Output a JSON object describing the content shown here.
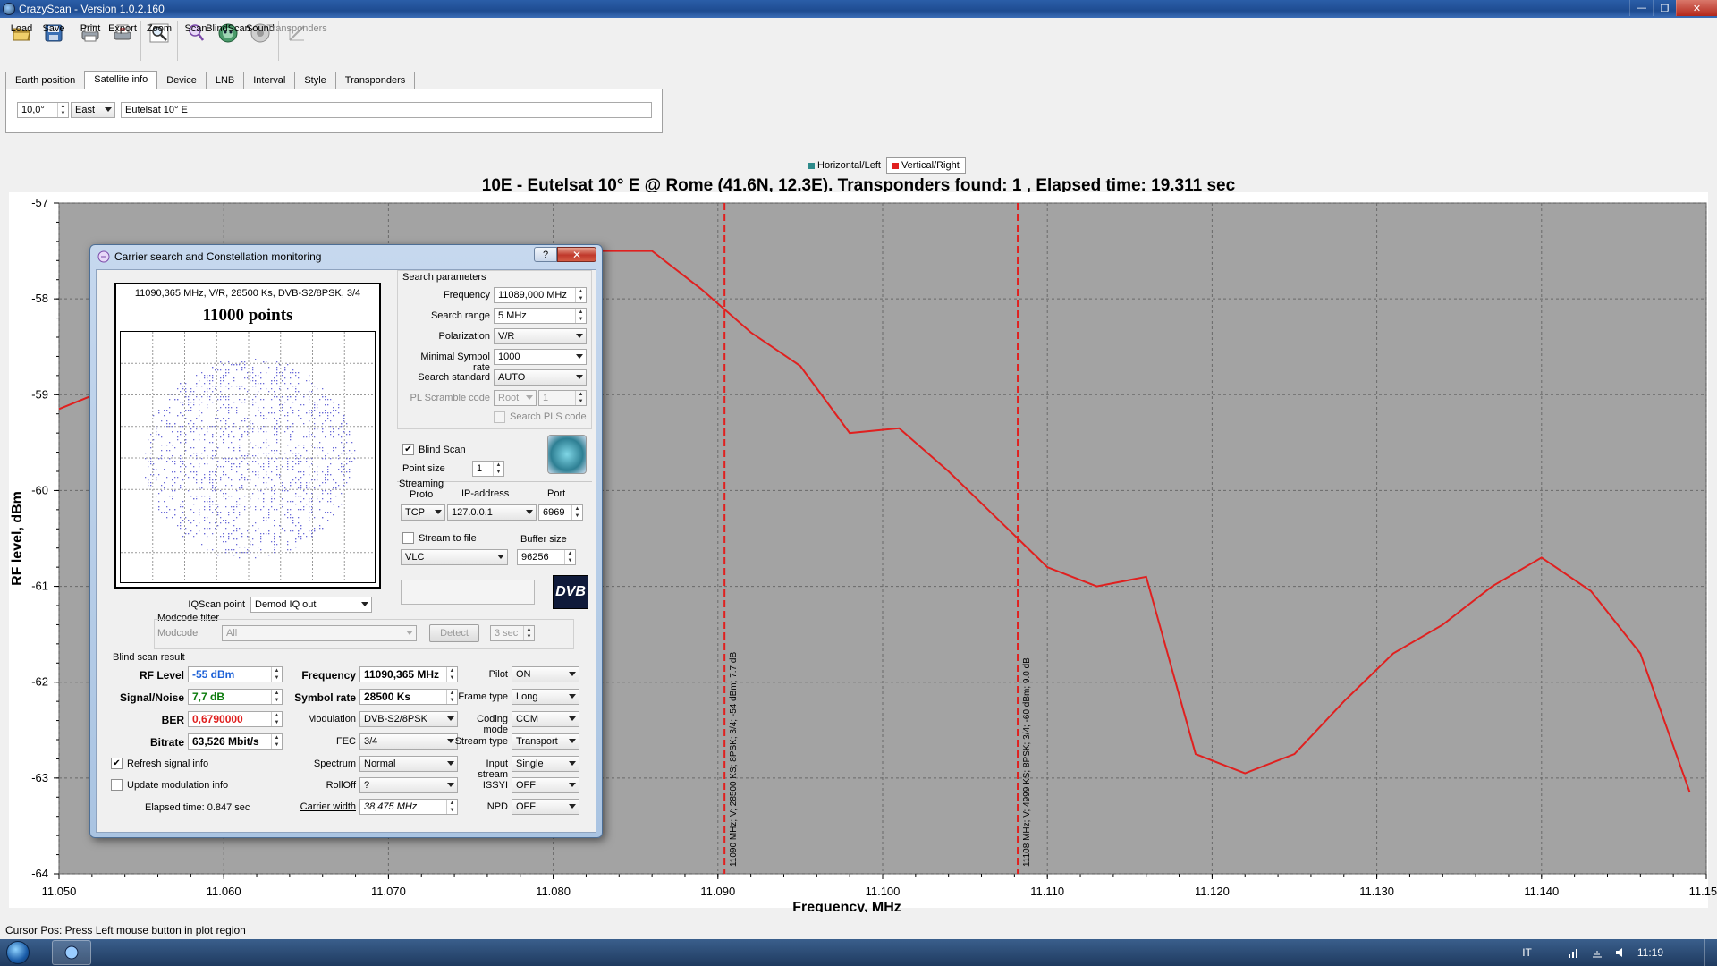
{
  "window": {
    "title": "CrazyScan - Version 1.0.2.160"
  },
  "toolbar": {
    "buttons": [
      {
        "id": "load",
        "label": "Load",
        "icon": "load-icon"
      },
      {
        "id": "save",
        "label": "Save",
        "icon": "save-icon"
      },
      {
        "id": "print",
        "label": "Print",
        "icon": "print-icon"
      },
      {
        "id": "export",
        "label": "Export",
        "icon": "export-icon"
      },
      {
        "id": "zoom",
        "label": "Zoom",
        "icon": "zoom-icon"
      },
      {
        "id": "scan",
        "label": "Scan",
        "icon": "scan-icon"
      },
      {
        "id": "blindscan",
        "label": "BlindScan",
        "icon": "blindscan-icon"
      },
      {
        "id": "sound",
        "label": "Sound",
        "icon": "sound-icon"
      },
      {
        "id": "transponders",
        "label": "Transponders",
        "icon": "transponders-icon",
        "disabled": true
      }
    ]
  },
  "tabs": [
    "Earth position",
    "Satellite info",
    "Device",
    "LNB",
    "Interval",
    "Style",
    "Transponders"
  ],
  "active_tab": "Satellite info",
  "satellite_info": {
    "position": "10,0°",
    "direction": "East",
    "name": "Eutelsat 10° E"
  },
  "legend": {
    "horizontal": "Horizontal/Left",
    "vertical": "Vertical/Right"
  },
  "colors": {
    "horizontal": "#2e8b8b",
    "vertical": "#e0201f",
    "plot_bg": "#a3a3a3"
  },
  "chart_data": {
    "type": "line",
    "title": "10E - Eutelsat 10° E  @ Rome (41.6N, 12.3E). Transponders found: 1 , Elapsed time: 19.311 sec",
    "xlabel": "Frequency, MHz",
    "ylabel": "RF level, dBm",
    "xlim": [
      11.05,
      11.15
    ],
    "ylim": [
      -64,
      -57
    ],
    "x_ticks": [
      "11.050",
      "11.060",
      "11.070",
      "11.080",
      "11.090",
      "11.100",
      "11.110",
      "11.120",
      "11.130",
      "11.140",
      "11.150"
    ],
    "y_ticks": [
      "-57",
      "-58",
      "-59",
      "-60",
      "-61",
      "-62",
      "-63",
      "-64"
    ],
    "grid": true,
    "series": [
      {
        "name": "Vertical/Right",
        "x": [
          11.05,
          11.055,
          11.08,
          11.086,
          11.089,
          11.092,
          11.095,
          11.098,
          11.101,
          11.104,
          11.107,
          11.11,
          11.113,
          11.116,
          11.119,
          11.122,
          11.125,
          11.128,
          11.131,
          11.134,
          11.137,
          11.14,
          11.143,
          11.146,
          11.149
        ],
        "y": [
          -59.15,
          -58.8,
          -57.5,
          -57.5,
          -57.9,
          -58.35,
          -58.7,
          -59.4,
          -59.35,
          -59.8,
          -60.3,
          -60.8,
          -61.0,
          -60.9,
          -62.75,
          -62.95,
          -62.75,
          -62.2,
          -61.7,
          -61.4,
          -61.0,
          -60.7,
          -61.05,
          -61.7,
          -63.15
        ]
      }
    ],
    "markers": [
      {
        "x": 11.0904,
        "label": "11090 MHz; V; 28500 KS; 8PSK; 3/4; -54 dBm; 7.7 dB"
      },
      {
        "x": 11.1082,
        "label": "11108 MHz; V; 4999 KS; 8PSK; 3/4; -60 dBm; 9.0 dB"
      }
    ]
  },
  "status": {
    "text": "Cursor Pos: Press Left mouse button in plot region"
  },
  "taskbar": {
    "language": "IT",
    "clock": "11:19"
  },
  "dialog": {
    "title": "Carrier search and Constellation monitoring",
    "help_label": "?",
    "close_label": "✕",
    "constellation": {
      "info": "11090,365 MHz, V/R, 28500 Ks, DVB-S2/8PSK, 3/4",
      "points": "11000 points"
    },
    "search_params": {
      "group": "Search parameters",
      "frequency_label": "Frequency",
      "frequency": "11089,000 MHz",
      "range_label": "Search range",
      "range": "5 MHz",
      "polarization_label": "Polarization",
      "polarization": "V/R",
      "min_sr_label": "Minimal Symbol rate",
      "min_sr": "1000",
      "standard_label": "Search standard",
      "standard": "AUTO",
      "pls_label": "PL Scramble code",
      "pls_mode": "Root",
      "pls_value": "1",
      "search_pls_label": "Search PLS code"
    },
    "blind_scan_label": "Blind Scan",
    "point_size_label": "Point size",
    "point_size": "1",
    "streaming": {
      "group": "Streaming",
      "proto_label": "Proto",
      "ip_label": "IP-address",
      "port_label": "Port",
      "proto": "TCP",
      "ip": "127.0.0.1",
      "port": "6969",
      "to_file_label": "Stream to file",
      "buffer_label": "Buffer size",
      "player": "VLC",
      "buffer": "96256"
    },
    "iqscan_label": "IQScan point",
    "iqscan": "Demod IQ out",
    "modcode": {
      "group": "Modcode filter",
      "label": "Modcode",
      "value": "All",
      "detect_label": "Detect",
      "time": "3 sec"
    },
    "result": {
      "group": "Blind scan result",
      "rf_label": "RF Level",
      "rf": "-55 dBm",
      "sn_label": "Signal/Noise",
      "sn": "7,7 dB",
      "ber_label": "BER",
      "ber": "0,6790000",
      "bitrate_label": "Bitrate",
      "bitrate": "63,526 Mbit/s",
      "freq_label": "Frequency",
      "freq": "11090,365 MHz",
      "sr_label": "Symbol rate",
      "sr": "28500 Ks",
      "mod_label": "Modulation",
      "mod": "DVB-S2/8PSK",
      "fec_label": "FEC",
      "fec": "3/4",
      "spectrum_label": "Spectrum",
      "spectrum": "Normal",
      "rolloff_label": "RollOff",
      "rolloff": "?",
      "carrier_label": "Carrier width",
      "carrier": "38,475 MHz",
      "pilot_label": "Pilot",
      "pilot": "ON",
      "frame_label": "Frame type",
      "frame": "Long",
      "coding_label": "Coding mode",
      "coding": "CCM",
      "stream_label": "Stream type",
      "stream": "Transport",
      "input_label": "Input stream",
      "input": "Single",
      "issyi_label": "ISSYI",
      "issyi": "OFF",
      "npd_label": "NPD",
      "npd": "OFF",
      "refresh_label": "Refresh signal info",
      "update_label": "Update modulation info",
      "elapsed": "Elapsed time: 0.847 sec",
      "rf_color": "#1a5fd6",
      "sn_color": "#0a7a0a",
      "ber_color": "#e0201f"
    },
    "dvb_logo": "DVB"
  }
}
